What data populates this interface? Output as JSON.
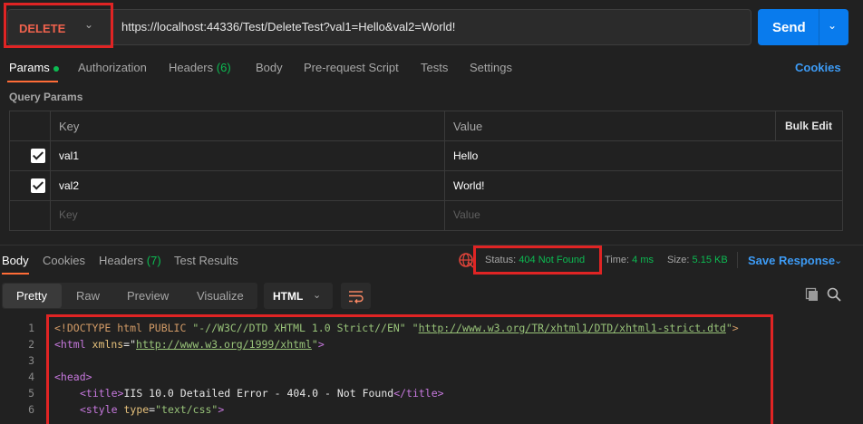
{
  "request": {
    "method": "DELETE",
    "url": "https://localhost:44336/Test/DeleteTest?val1=Hello&val2=World!",
    "send_label": "Send"
  },
  "request_tabs": {
    "params": "Params",
    "authorization": "Authorization",
    "headers": "Headers",
    "headers_count": "(6)",
    "body": "Body",
    "prerequest": "Pre-request Script",
    "tests": "Tests",
    "settings": "Settings",
    "cookies": "Cookies"
  },
  "query_params": {
    "title": "Query Params",
    "col_key": "Key",
    "col_value": "Value",
    "bulk_edit": "Bulk Edit",
    "rows": [
      {
        "key": "val1",
        "value": "Hello",
        "checked": true
      },
      {
        "key": "val2",
        "value": "World!",
        "checked": true
      }
    ],
    "key_placeholder": "Key",
    "value_placeholder": "Value"
  },
  "response_tabs": {
    "body": "Body",
    "cookies": "Cookies",
    "headers": "Headers",
    "headers_count": "(7)",
    "test_results": "Test Results"
  },
  "response_meta": {
    "status_label": "Status:",
    "status_value": "404 Not Found",
    "time_label": "Time:",
    "time_value": "4 ms",
    "size_label": "Size:",
    "size_value": "5.15 KB",
    "save_response": "Save Response"
  },
  "view_modes": {
    "pretty": "Pretty",
    "raw": "Raw",
    "preview": "Preview",
    "visualize": "Visualize",
    "format": "HTML"
  },
  "code": {
    "line_numbers": [
      "1",
      "2",
      "3",
      "4",
      "5",
      "6"
    ],
    "l1_a": "<!DOCTYPE html PUBLIC ",
    "l1_b": "\"-//W3C//DTD XHTML 1.0 Strict//EN\"",
    "l1_c": " \"",
    "l1_d": "http://www.w3.org/TR/xhtml1/DTD/xhtml1-strict.dtd",
    "l1_e": "\"",
    "l1_f": ">",
    "l2_a": "<html",
    "l2_b": " xmlns",
    "l2_c": "=\"",
    "l2_d": "http://www.w3.org/1999/xhtml",
    "l2_e": "\"",
    "l2_f": ">",
    "l4": "<head>",
    "l5_a": "<title>",
    "l5_b": "IIS 10.0 Detailed Error - 404.0 - Not Found",
    "l5_c": "</title>",
    "l6_a": "<style",
    "l6_b": " type",
    "l6_c": "=",
    "l6_d": "\"text/css\"",
    "l6_e": ">"
  },
  "colors": {
    "accent": "#ff6c37",
    "send": "#097bed",
    "success": "#0cbb52",
    "highlight": "#e02424"
  },
  "icons": [
    "chevron-down-icon",
    "globe-icon",
    "wrap-icon",
    "copy-icon",
    "search-icon"
  ]
}
